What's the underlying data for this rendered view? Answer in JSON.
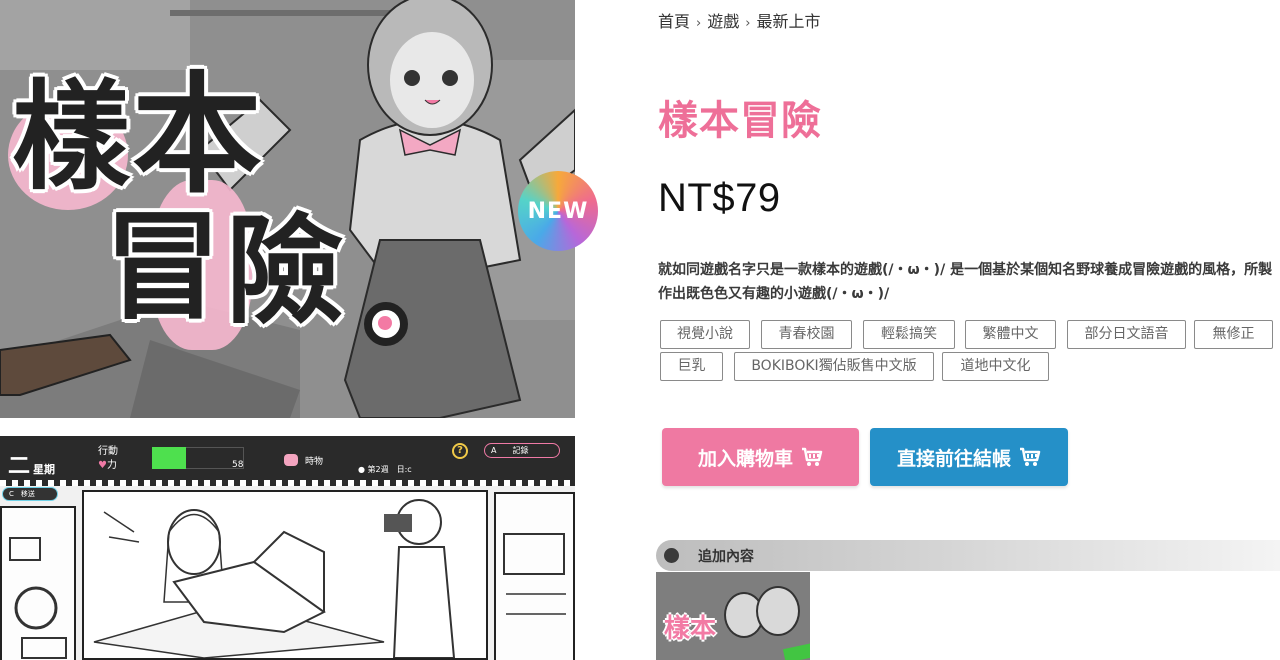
{
  "breadcrumb": {
    "home": "首頁",
    "category": "遊戲",
    "current": "最新上市",
    "separator": "›"
  },
  "product": {
    "title": "樣本冒險",
    "price": "NT$79",
    "description": "就如同遊戲名字只是一款樣本的遊戲(/・ω・)/ 是一個基於某個知名野球養成冒險遊戲的風格，所製作出既色色又有趣的小遊戲(/・ω・)/",
    "tags": [
      "視覺小說",
      "青春校園",
      "輕鬆搞笑",
      "繁體中文",
      "部分日文語音",
      "無修正",
      "巨乳",
      "BOKIBOKI獨佔販售中文版",
      "道地中文化"
    ]
  },
  "buttons": {
    "add_to_cart": "加入購物車",
    "checkout": "直接前往結帳",
    "icon": "cart-icon"
  },
  "addon": {
    "label": "追加內容"
  },
  "cover": {
    "title_chars": [
      "樣",
      "本",
      "冒",
      "險"
    ],
    "badge": "NEW"
  },
  "game_screenshot": {
    "day": "二",
    "day_suffix": "星期",
    "action_label": "行動",
    "stamina_label": "力",
    "stamina_value": "58",
    "pig_label": "時物",
    "week": "● 第2週　日:c",
    "help": "?",
    "save": "A　　記錄",
    "side_tag": "C　移送"
  },
  "colors": {
    "pink": "#ee6f98",
    "cart_button": "#ef79a2",
    "checkout_button": "#2590c8"
  }
}
